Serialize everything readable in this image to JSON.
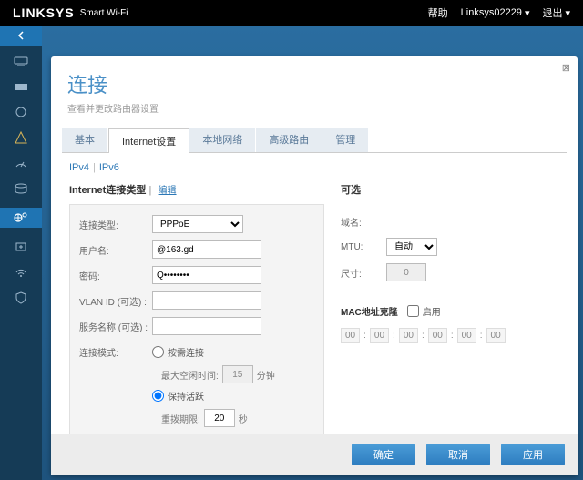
{
  "top": {
    "brand": "LINKSYS",
    "sub": "Smart Wi-Fi",
    "help": "帮助",
    "account": "Linksys02229",
    "logout": "退出"
  },
  "modal": {
    "title": "连接",
    "subtitle": "查看并更改路由器设置",
    "tabs": [
      "基本",
      "Internet设置",
      "本地网络",
      "高级路由",
      "管理"
    ],
    "activeTab": 1,
    "subtabs": {
      "a": "IPv4",
      "b": "IPv6"
    },
    "left": {
      "section": "Internet连接类型",
      "edit": "编辑",
      "labels": {
        "type": "连接类型:",
        "user": "用户名:",
        "pass": "密码:",
        "vlan": "VLAN ID (可选) :",
        "svc": "服务名称 (可选) :",
        "mode": "连接模式:"
      },
      "type_value": "PPPoE",
      "user_value": "@163.gd",
      "pass_value": "Q••••••••",
      "vlan_value": "",
      "svc_value": "",
      "radio_demand": "按需连接",
      "idle_label": "最大空闲时间:",
      "idle_value": "15",
      "idle_unit": "分钟",
      "radio_keep": "保持活跃",
      "redial_label": "重拨期限:",
      "redial_value": "20",
      "redial_unit": "秒"
    },
    "right": {
      "section": "可选",
      "domain_label": "域名:",
      "mtu_label": "MTU:",
      "mtu_value": "自动",
      "size_label": "尺寸:",
      "size_value": "0",
      "mac_label": "MAC地址克隆",
      "mac_enable": "启用",
      "mac_octets": [
        "00",
        "00",
        "00",
        "00",
        "00",
        "00"
      ]
    },
    "footer": {
      "ok": "确定",
      "cancel": "取消",
      "apply": "应用"
    }
  }
}
